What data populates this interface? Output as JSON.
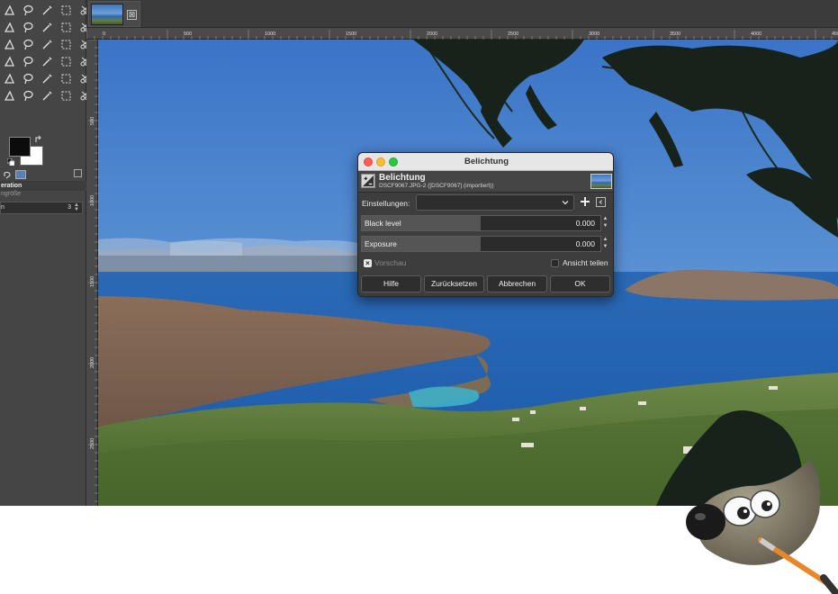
{
  "toolbox": {
    "tool_icons": [
      "free-select-icon",
      "lasso-icon",
      "fuzzy-select-icon",
      "by-color-select-icon",
      "scissors-icon",
      "paths-icon",
      "color-picker-icon",
      "zoom-icon",
      "measure-icon",
      "move-icon",
      "align-icon",
      "crop-icon",
      "transform-icon",
      "unified-transform-icon",
      "warp-icon",
      "cage-icon",
      "flip-icon",
      "perspective-icon",
      "bucket-fill-icon",
      "text-icon",
      "paintbrush-icon",
      "pencil-icon",
      "airbrush-icon",
      "eraser-icon",
      "ink-icon",
      "heal-icon",
      "clone-icon",
      "smudge-icon",
      "dodge-burn-icon",
      "blur-icon"
    ],
    "fg_color": "#0c0c0c",
    "bg_color": "#ffffff",
    "options_header": "eration",
    "options_sub": "ngröße",
    "options_field_label": "n",
    "options_field_value": "3"
  },
  "tab": {
    "close_glyph": "⊠"
  },
  "ruler": {
    "top_labels": [
      "0",
      "500",
      "1000",
      "1500",
      "2000",
      "2500",
      "3000",
      "3500",
      "4000",
      "4500"
    ],
    "left_labels": [
      "500",
      "1000",
      "1500",
      "2000",
      "2500"
    ]
  },
  "dialog": {
    "window_title": "Belichtung",
    "header_title": "Belichtung",
    "header_subtitle": "DSCF9067.JPG-2 ([DSCF9067] (importiert))",
    "settings_label": "Einstellungen:",
    "settings_value": "",
    "sliders": [
      {
        "label": "Black level",
        "value": "0.000"
      },
      {
        "label": "Exposure",
        "value": "0.000"
      }
    ],
    "preview_label": "Vorschau",
    "preview_checked": true,
    "split_view_label": "Ansicht teilen",
    "split_view_checked": false,
    "buttons": {
      "help": "Hilfe",
      "reset": "Zurücksetzen",
      "cancel": "Abbrechen",
      "ok": "OK"
    }
  },
  "colors": {
    "accent_red": "#ff5f57",
    "accent_yellow": "#febc2e",
    "accent_green": "#28c840",
    "dialog_bg": "#3d3d3d",
    "sea": "#1f63b3"
  }
}
